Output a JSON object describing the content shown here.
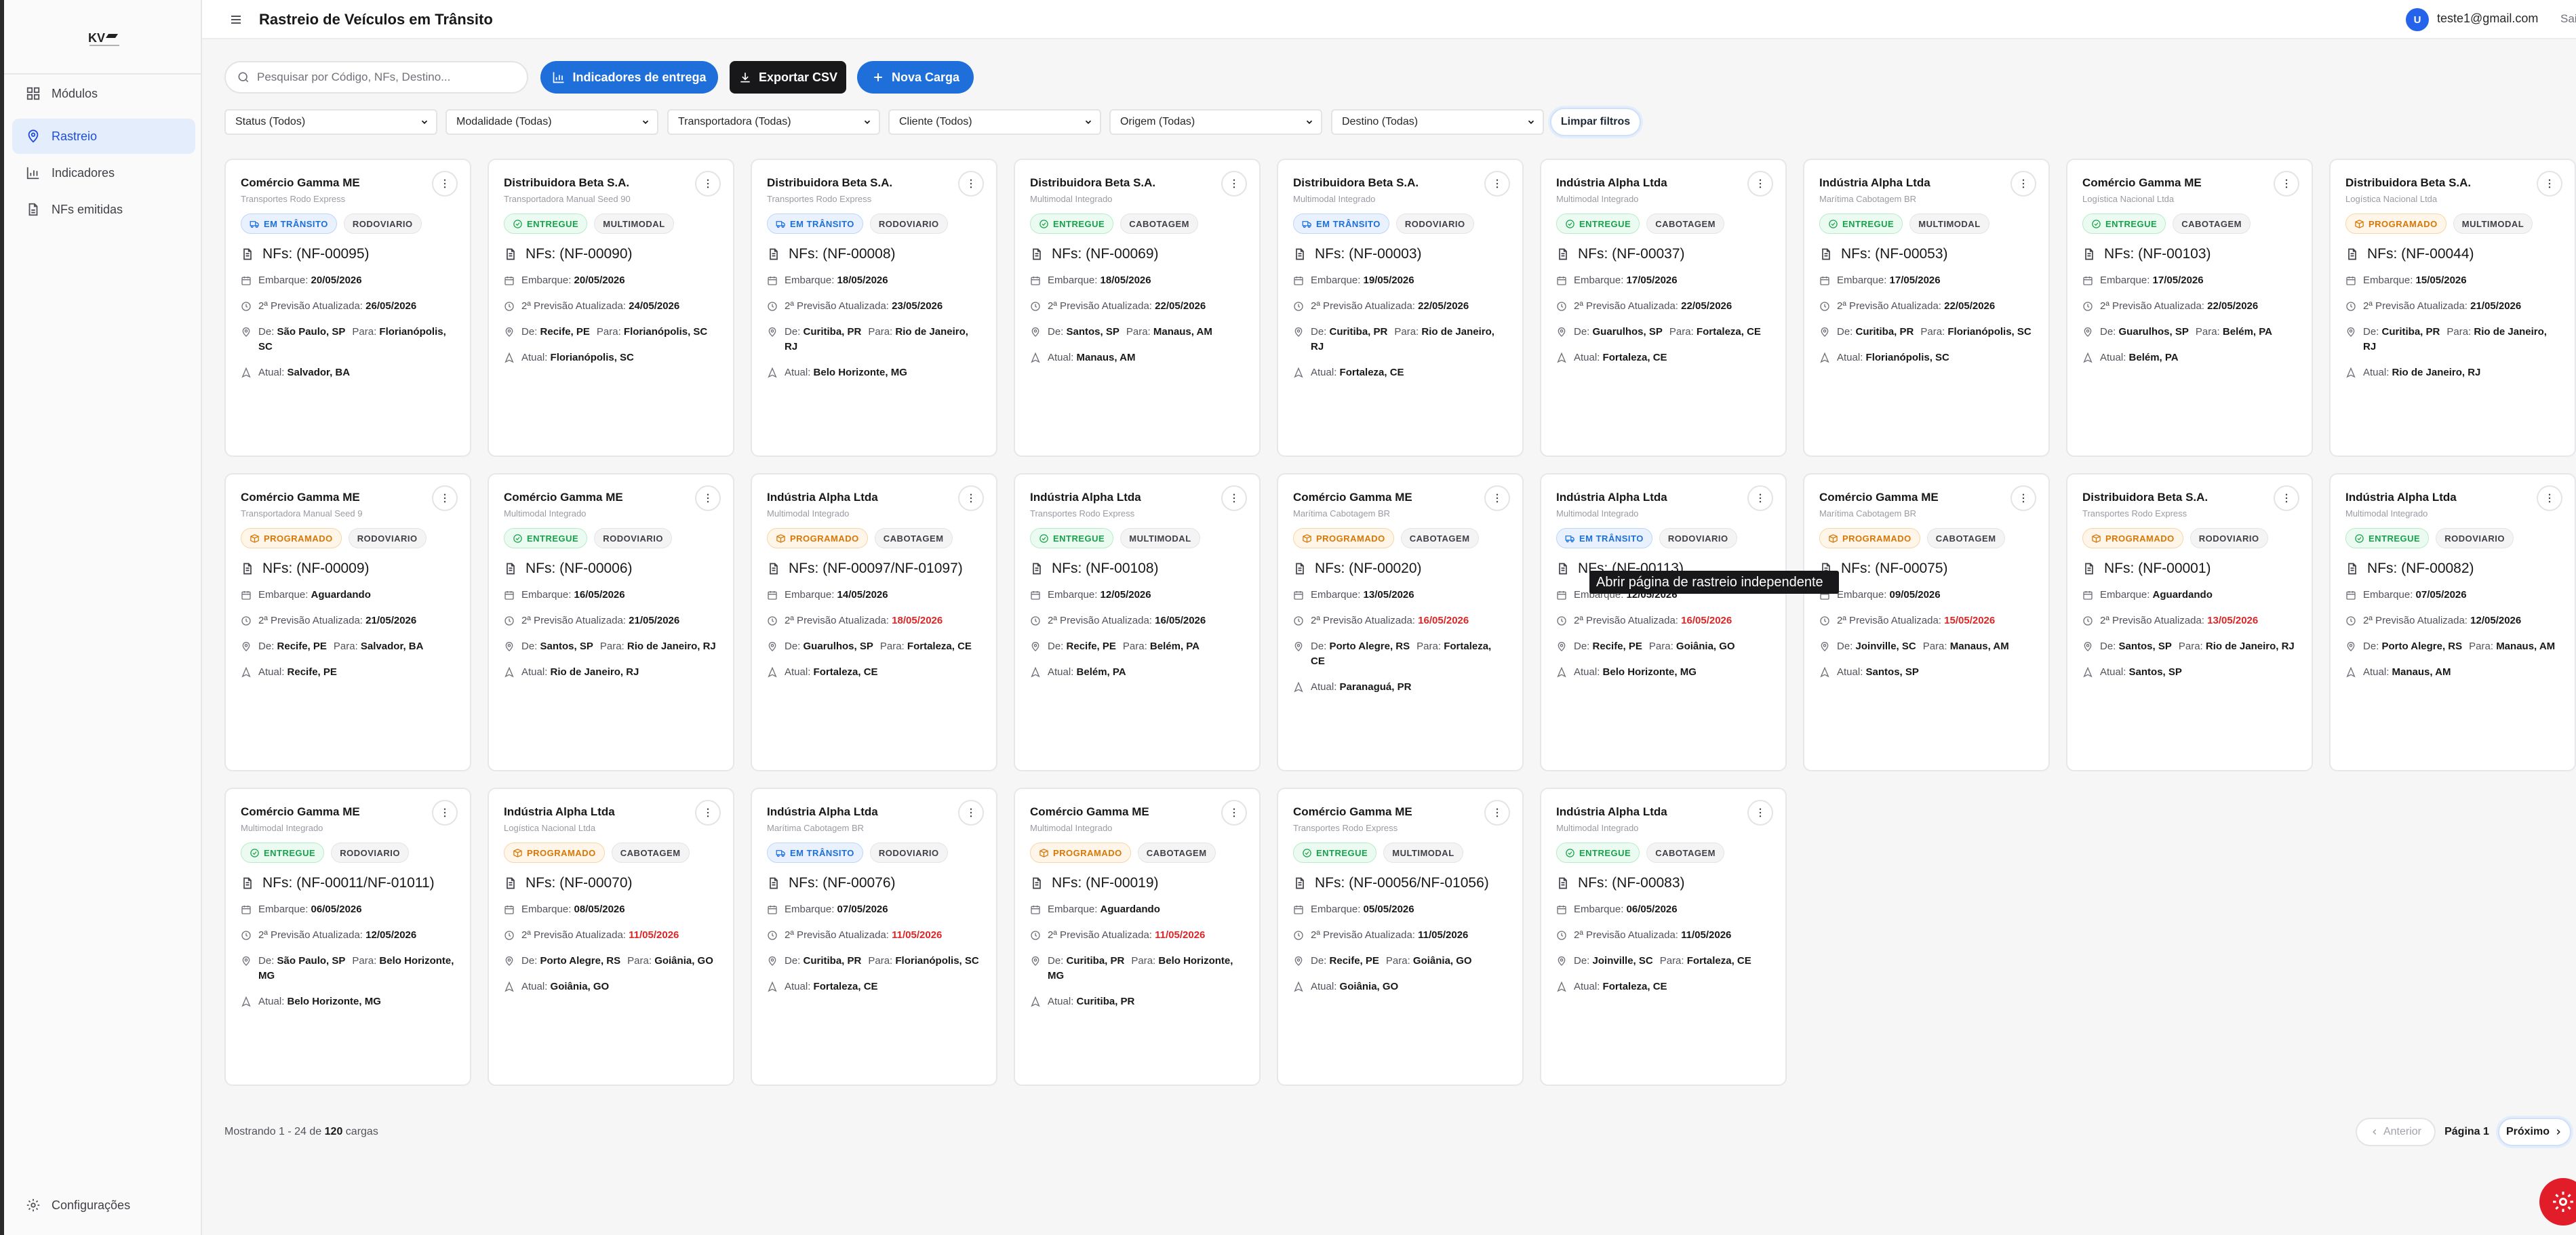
{
  "sidebar": {
    "items": [
      {
        "label": "Módulos",
        "icon": "grid-icon",
        "active": false
      },
      {
        "label": "Rastreio",
        "icon": "map-pin-icon",
        "active": true
      },
      {
        "label": "Indicadores",
        "icon": "bar-chart-icon",
        "active": false
      },
      {
        "label": "NFs emitidas",
        "icon": "document-icon",
        "active": false
      }
    ],
    "settings_label": "Configurações"
  },
  "header": {
    "title": "Rastreio de Veículos em Trânsito",
    "avatar_initial": "U",
    "user_email": "teste1@gmail.com",
    "logout_label": "Sair"
  },
  "toolbar": {
    "search_placeholder": "Pesquisar por Código, NFs, Destino...",
    "indicators_label": "Indicadores de entrega",
    "export_label": "Exportar CSV",
    "new_cargo_label": "Nova Carga"
  },
  "filters": [
    "Status (Todos)",
    "Modalidade (Todas)",
    "Transportadora (Todas)",
    "Cliente (Todos)",
    "Origem (Todas)",
    "Destino (Todas)"
  ],
  "clear_filters_label": "Limpar filtros",
  "labels": {
    "embarque": "Embarque:",
    "previsao": "2ª Previsão Atualizada:",
    "de": "De:",
    "para": "Para:",
    "atual": "Atual:"
  },
  "cards": [
    {
      "client": "Comércio Gamma ME",
      "carrier": "Transportes Rodo Express",
      "status": "EM TRÂNSITO",
      "modality": "RODOVIARIO",
      "nfs": "NFs: (NF-00095)",
      "embarque": "20/05/2026",
      "previsao": "26/05/2026",
      "late": false,
      "de": "São Paulo, SP",
      "para": "Florianópolis, SC",
      "atual": "Salvador, BA"
    },
    {
      "client": "Distribuidora Beta S.A.",
      "carrier": "Transportadora Manual Seed 90",
      "status": "ENTREGUE",
      "modality": "MULTIMODAL",
      "nfs": "NFs: (NF-00090)",
      "embarque": "20/05/2026",
      "previsao": "24/05/2026",
      "late": false,
      "de": "Recife, PE",
      "para": "Florianópolis, SC",
      "atual": "Florianópolis, SC"
    },
    {
      "client": "Distribuidora Beta S.A.",
      "carrier": "Transportes Rodo Express",
      "status": "EM TRÂNSITO",
      "modality": "RODOVIARIO",
      "nfs": "NFs: (NF-00008)",
      "embarque": "18/05/2026",
      "previsao": "23/05/2026",
      "late": false,
      "de": "Curitiba, PR",
      "para": "Rio de Janeiro, RJ",
      "atual": "Belo Horizonte, MG"
    },
    {
      "client": "Distribuidora Beta S.A.",
      "carrier": "Multimodal Integrado",
      "status": "ENTREGUE",
      "modality": "CABOTAGEM",
      "nfs": "NFs: (NF-00069)",
      "embarque": "18/05/2026",
      "previsao": "22/05/2026",
      "late": false,
      "de": "Santos, SP",
      "para": "Manaus, AM",
      "atual": "Manaus, AM"
    },
    {
      "client": "Distribuidora Beta S.A.",
      "carrier": "Multimodal Integrado",
      "status": "EM TRÂNSITO",
      "modality": "RODOVIARIO",
      "nfs": "NFs: (NF-00003)",
      "embarque": "19/05/2026",
      "previsao": "22/05/2026",
      "late": false,
      "de": "Curitiba, PR",
      "para": "Rio de Janeiro, RJ",
      "atual": "Fortaleza, CE"
    },
    {
      "client": "Indústria Alpha Ltda",
      "carrier": "Multimodal Integrado",
      "status": "ENTREGUE",
      "modality": "CABOTAGEM",
      "nfs": "NFs: (NF-00037)",
      "embarque": "17/05/2026",
      "previsao": "22/05/2026",
      "late": false,
      "de": "Guarulhos, SP",
      "para": "Fortaleza, CE",
      "atual": "Fortaleza, CE"
    },
    {
      "client": "Indústria Alpha Ltda",
      "carrier": "Marítima Cabotagem BR",
      "status": "ENTREGUE",
      "modality": "MULTIMODAL",
      "nfs": "NFs: (NF-00053)",
      "embarque": "17/05/2026",
      "previsao": "22/05/2026",
      "late": false,
      "de": "Curitiba, PR",
      "para": "Florianópolis, SC",
      "atual": "Florianópolis, SC"
    },
    {
      "client": "Comércio Gamma ME",
      "carrier": "Logística Nacional Ltda",
      "status": "ENTREGUE",
      "modality": "CABOTAGEM",
      "nfs": "NFs: (NF-00103)",
      "embarque": "17/05/2026",
      "previsao": "22/05/2026",
      "late": false,
      "de": "Guarulhos, SP",
      "para": "Belém, PA",
      "atual": "Belém, PA"
    },
    {
      "client": "Distribuidora Beta S.A.",
      "carrier": "Logística Nacional Ltda",
      "status": "PROGRAMADO",
      "modality": "MULTIMODAL",
      "nfs": "NFs: (NF-00044)",
      "embarque": "15/05/2026",
      "previsao": "21/05/2026",
      "late": false,
      "de": "Curitiba, PR",
      "para": "Rio de Janeiro, RJ",
      "atual": "Rio de Janeiro, RJ"
    },
    {
      "client": "Comércio Gamma ME",
      "carrier": "Transportadora Manual Seed 9",
      "status": "PROGRAMADO",
      "modality": "RODOVIARIO",
      "nfs": "NFs: (NF-00009)",
      "embarque": "Aguardando",
      "previsao": "21/05/2026",
      "late": false,
      "de": "Recife, PE",
      "para": "Salvador, BA",
      "atual": "Recife, PE"
    },
    {
      "client": "Comércio Gamma ME",
      "carrier": "Multimodal Integrado",
      "status": "ENTREGUE",
      "modality": "RODOVIARIO",
      "nfs": "NFs: (NF-00006)",
      "embarque": "16/05/2026",
      "previsao": "21/05/2026",
      "late": false,
      "de": "Santos, SP",
      "para": "Rio de Janeiro, RJ",
      "atual": "Rio de Janeiro, RJ"
    },
    {
      "client": "Indústria Alpha Ltda",
      "carrier": "Multimodal Integrado",
      "status": "PROGRAMADO",
      "modality": "CABOTAGEM",
      "nfs": "NFs: (NF-00097/NF-01097)",
      "embarque": "14/05/2026",
      "previsao": "18/05/2026",
      "late": true,
      "de": "Guarulhos, SP",
      "para": "Fortaleza, CE",
      "atual": "Fortaleza, CE"
    },
    {
      "client": "Indústria Alpha Ltda",
      "carrier": "Transportes Rodo Express",
      "status": "ENTREGUE",
      "modality": "MULTIMODAL",
      "nfs": "NFs: (NF-00108)",
      "embarque": "12/05/2026",
      "previsao": "16/05/2026",
      "late": false,
      "de": "Recife, PE",
      "para": "Belém, PA",
      "atual": "Belém, PA"
    },
    {
      "client": "Comércio Gamma ME",
      "carrier": "Marítima Cabotagem BR",
      "status": "PROGRAMADO",
      "modality": "CABOTAGEM",
      "nfs": "NFs: (NF-00020)",
      "embarque": "13/05/2026",
      "previsao": "16/05/2026",
      "late": true,
      "de": "Porto Alegre, RS",
      "para": "Fortaleza, CE",
      "atual": "Paranaguá, PR"
    },
    {
      "client": "Indústria Alpha Ltda",
      "carrier": "Multimodal Integrado",
      "status": "EM TRÂNSITO",
      "modality": "RODOVIARIO",
      "nfs": "NFs: (NF-00113)",
      "embarque": "12/05/2026",
      "previsao": "16/05/2026",
      "late": true,
      "de": "Recife, PE",
      "para": "Goiânia, GO",
      "atual": "Belo Horizonte, MG"
    },
    {
      "client": "Comércio Gamma ME",
      "carrier": "Marítima Cabotagem BR",
      "status": "PROGRAMADO",
      "modality": "CABOTAGEM",
      "nfs": "NFs: (NF-00075)",
      "embarque": "09/05/2026",
      "previsao": "15/05/2026",
      "late": true,
      "de": "Joinville, SC",
      "para": "Manaus, AM",
      "atual": "Santos, SP"
    },
    {
      "client": "Distribuidora Beta S.A.",
      "carrier": "Transportes Rodo Express",
      "status": "PROGRAMADO",
      "modality": "RODOVIARIO",
      "nfs": "NFs: (NF-00001)",
      "embarque": "Aguardando",
      "previsao": "13/05/2026",
      "late": true,
      "de": "Santos, SP",
      "para": "Rio de Janeiro, RJ",
      "atual": "Santos, SP"
    },
    {
      "client": "Indústria Alpha Ltda",
      "carrier": "Multimodal Integrado",
      "status": "ENTREGUE",
      "modality": "RODOVIARIO",
      "nfs": "NFs: (NF-00082)",
      "embarque": "07/05/2026",
      "previsao": "12/05/2026",
      "late": false,
      "de": "Porto Alegre, RS",
      "para": "Manaus, AM",
      "atual": "Manaus, AM"
    },
    {
      "client": "Comércio Gamma ME",
      "carrier": "Multimodal Integrado",
      "status": "ENTREGUE",
      "modality": "RODOVIARIO",
      "nfs": "NFs: (NF-00011/NF-01011)",
      "embarque": "06/05/2026",
      "previsao": "12/05/2026",
      "late": false,
      "de": "São Paulo, SP",
      "para": "Belo Horizonte, MG",
      "atual": "Belo Horizonte, MG"
    },
    {
      "client": "Indústria Alpha Ltda",
      "carrier": "Logística Nacional Ltda",
      "status": "PROGRAMADO",
      "modality": "CABOTAGEM",
      "nfs": "NFs: (NF-00070)",
      "embarque": "08/05/2026",
      "previsao": "11/05/2026",
      "late": true,
      "de": "Porto Alegre, RS",
      "para": "Goiânia, GO",
      "atual": "Goiânia, GO"
    },
    {
      "client": "Indústria Alpha Ltda",
      "carrier": "Marítima Cabotagem BR",
      "status": "EM TRÂNSITO",
      "modality": "RODOVIARIO",
      "nfs": "NFs: (NF-00076)",
      "embarque": "07/05/2026",
      "previsao": "11/05/2026",
      "late": true,
      "de": "Curitiba, PR",
      "para": "Florianópolis, SC",
      "atual": "Fortaleza, CE"
    },
    {
      "client": "Comércio Gamma ME",
      "carrier": "Multimodal Integrado",
      "status": "PROGRAMADO",
      "modality": "CABOTAGEM",
      "nfs": "NFs: (NF-00019)",
      "embarque": "Aguardando",
      "previsao": "11/05/2026",
      "late": true,
      "de": "Curitiba, PR",
      "para": "Belo Horizonte, MG",
      "atual": "Curitiba, PR"
    },
    {
      "client": "Comércio Gamma ME",
      "carrier": "Transportes Rodo Express",
      "status": "ENTREGUE",
      "modality": "MULTIMODAL",
      "nfs": "NFs: (NF-00056/NF-01056)",
      "embarque": "05/05/2026",
      "previsao": "11/05/2026",
      "late": false,
      "de": "Recife, PE",
      "para": "Goiânia, GO",
      "atual": "Goiânia, GO"
    },
    {
      "client": "Indústria Alpha Ltda",
      "carrier": "Multimodal Integrado",
      "status": "ENTREGUE",
      "modality": "CABOTAGEM",
      "nfs": "NFs: (NF-00083)",
      "embarque": "06/05/2026",
      "previsao": "11/05/2026",
      "late": false,
      "de": "Joinville, SC",
      "para": "Fortaleza, CE",
      "atual": "Fortaleza, CE"
    }
  ],
  "tooltip": "Abrir página de rastreio independente",
  "pagination": {
    "showing_prefix": "Mostrando 1 - 24 de ",
    "total": "120",
    "showing_suffix": " cargas",
    "prev_label": "Anterior",
    "page_label": "Página 1",
    "next_label": "Próximo"
  },
  "colors": {
    "primary": "#1e6fd9",
    "entregue": "#16a34a",
    "em_transito": "#1d6fd8",
    "programado": "#d97706",
    "late": "#dc2626",
    "fab": "#e11d2a"
  }
}
